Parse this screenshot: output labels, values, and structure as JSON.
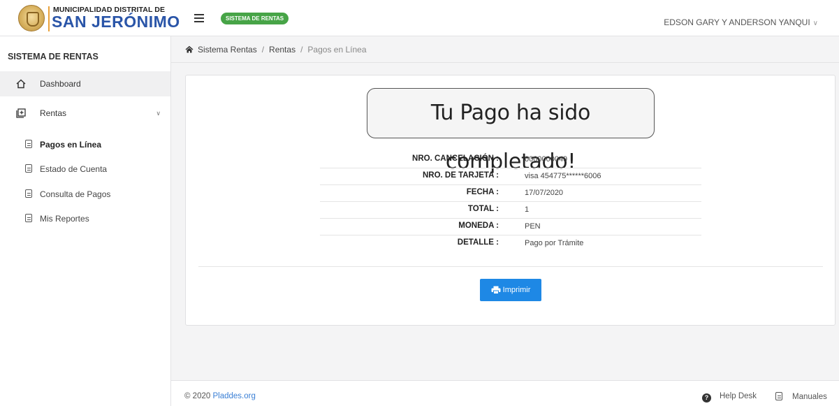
{
  "header": {
    "logo_top": "MUNICIPALIDAD DISTRITAL DE",
    "logo_main": "SAN JERÓNIMO",
    "system_badge": "SISTEMA DE RENTAS",
    "user_name": "EDSON GARY Y ANDERSON YANQUI",
    "menu_icon": "hamburger-icon",
    "user_chevron_icon": "chevron-down-icon"
  },
  "sidebar": {
    "title": "SISTEMA DE RENTAS",
    "items": [
      {
        "label": "Dashboard",
        "icon": "home-icon"
      },
      {
        "label": "Rentas",
        "icon": "folder-plus-icon"
      }
    ],
    "sub_items": [
      {
        "label": "Pagos en Línea",
        "icon": "document-icon"
      },
      {
        "label": "Estado de Cuenta",
        "icon": "document-icon"
      },
      {
        "label": "Consulta de Pagos",
        "icon": "document-icon"
      },
      {
        "label": "Mis Reportes",
        "icon": "document-icon"
      }
    ]
  },
  "breadcrumb": [
    "Sistema Rentas",
    "Rentas",
    "Pagos en Línea"
  ],
  "main": {
    "success_message": "Tu Pago ha sido completado!",
    "details": [
      {
        "label": "NRO. CANCELACIÓN :",
        "value": "0000000049"
      },
      {
        "label": "NRO. DE TARJETA :",
        "value": "visa 454775******6006"
      },
      {
        "label": "FECHA :",
        "value": "17/07/2020"
      },
      {
        "label": "TOTAL :",
        "value": "1"
      },
      {
        "label": "MONEDA :",
        "value": "PEN"
      },
      {
        "label": "DETALLE :",
        "value": "Pago por Trámite"
      }
    ],
    "print_label": "Imprimir",
    "print_icon": "printer-icon"
  },
  "footer": {
    "copyright": "© 2020",
    "link": "Pladdes.org",
    "help_desk": "Help Desk",
    "manuals": "Manuales"
  },
  "colors": {
    "accent": "#1e88e5",
    "badge": "#47a447",
    "logo_blue": "#2a55a8"
  }
}
